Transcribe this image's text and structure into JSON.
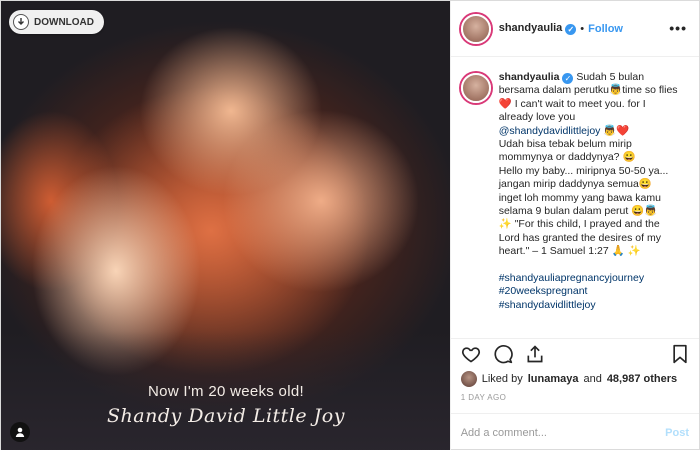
{
  "media": {
    "download_label": "DOWNLOAD",
    "overlay_line1": "Now I'm 20 weeks old!",
    "overlay_line2": "Shandy David Little Joy"
  },
  "header": {
    "username": "shandyaulia",
    "separator": "•",
    "follow_label": "Follow",
    "more_label": "•••"
  },
  "caption": {
    "username": "shandyaulia",
    "lines": [
      "Sudah 5 bulan bersama dalam perutku👼time so flies ❤️ I can't wait to meet you. for I already love you",
      "Udah bisa tebak belum mirip mommynya or daddynya? 😀",
      "Hello my baby... miripnya 50-50 ya... jangan mirip daddynya semua😀",
      "inget loh mommy yang bawa kamu selama 9 bulan dalam perut 😀👼",
      "✨ \"For this child, I prayed and the Lord has granted the desires of my heart.\" – 1 Samuel 1:27 🙏 ✨"
    ],
    "mention": "@shandydavidlittlejoy",
    "mention_suffix": " 👼❤️",
    "hashtags": [
      "#shandyauliapregnancyjourney",
      "#20weekspregnant",
      "#shandydavidlittlejoy"
    ]
  },
  "likes": {
    "prefix": "Liked by",
    "user": "lunamaya",
    "joiner": "and",
    "others": "48,987 others"
  },
  "timestamp": "1 DAY AGO",
  "comment": {
    "placeholder": "Add a comment...",
    "post_label": "Post"
  },
  "colors": {
    "accent": "#3897f0",
    "link": "#003569",
    "muted": "#999999"
  }
}
